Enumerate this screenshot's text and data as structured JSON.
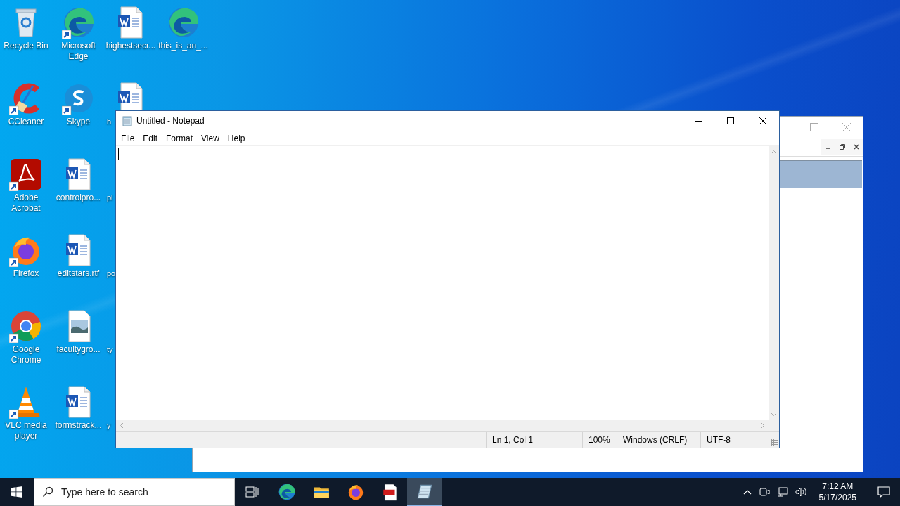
{
  "desktop": {
    "columns": [
      [
        {
          "label": "Recycle Bin",
          "kind": "recycle"
        },
        {
          "label": "CCleaner",
          "kind": "ccleaner",
          "shortcut": true
        },
        {
          "label": "Adobe Acrobat",
          "kind": "acrobat",
          "shortcut": true
        },
        {
          "label": "Firefox",
          "kind": "firefox",
          "shortcut": true
        },
        {
          "label": "Google Chrome",
          "kind": "chrome",
          "shortcut": true
        },
        {
          "label": "VLC media player",
          "kind": "vlc",
          "shortcut": true
        }
      ],
      [
        {
          "label": "Microsoft Edge",
          "kind": "edge",
          "shortcut": true
        },
        {
          "label": "Skype",
          "kind": "skype",
          "shortcut": true
        },
        {
          "label": "controlpro...",
          "kind": "word"
        },
        {
          "label": "editstars.rtf",
          "kind": "word"
        },
        {
          "label": "facultygro...",
          "kind": "image"
        },
        {
          "label": "formstrack...",
          "kind": "word"
        }
      ],
      [
        {
          "label": "highestsecr...",
          "kind": "word"
        },
        {
          "label": "h",
          "kind": "word",
          "cut": true
        },
        {
          "label": "pl",
          "cut": true
        },
        {
          "label": "po",
          "cut": true
        },
        {
          "label": "ty",
          "cut": true
        },
        {
          "label": "y",
          "cut": true
        }
      ],
      [
        {
          "label": "this_is_an_...",
          "kind": "edge"
        }
      ]
    ]
  },
  "notepad": {
    "title": "Untitled - Notepad",
    "menu": [
      "File",
      "Edit",
      "Format",
      "View",
      "Help"
    ],
    "status": [
      "Ln 1, Col 1",
      "100%",
      "Windows (CRLF)",
      "UTF-8"
    ]
  },
  "taskbar": {
    "search": {
      "placeholder": "Type here to search"
    },
    "apps": [
      {
        "kind": "edge",
        "selected": false
      },
      {
        "kind": "explorer",
        "selected": false
      },
      {
        "kind": "firefox",
        "selected": false
      },
      {
        "kind": "pdf",
        "selected": false
      },
      {
        "kind": "notepad",
        "selected": true
      }
    ],
    "clock": {
      "time": "7:12 AM",
      "date": "5/17/2025"
    }
  }
}
